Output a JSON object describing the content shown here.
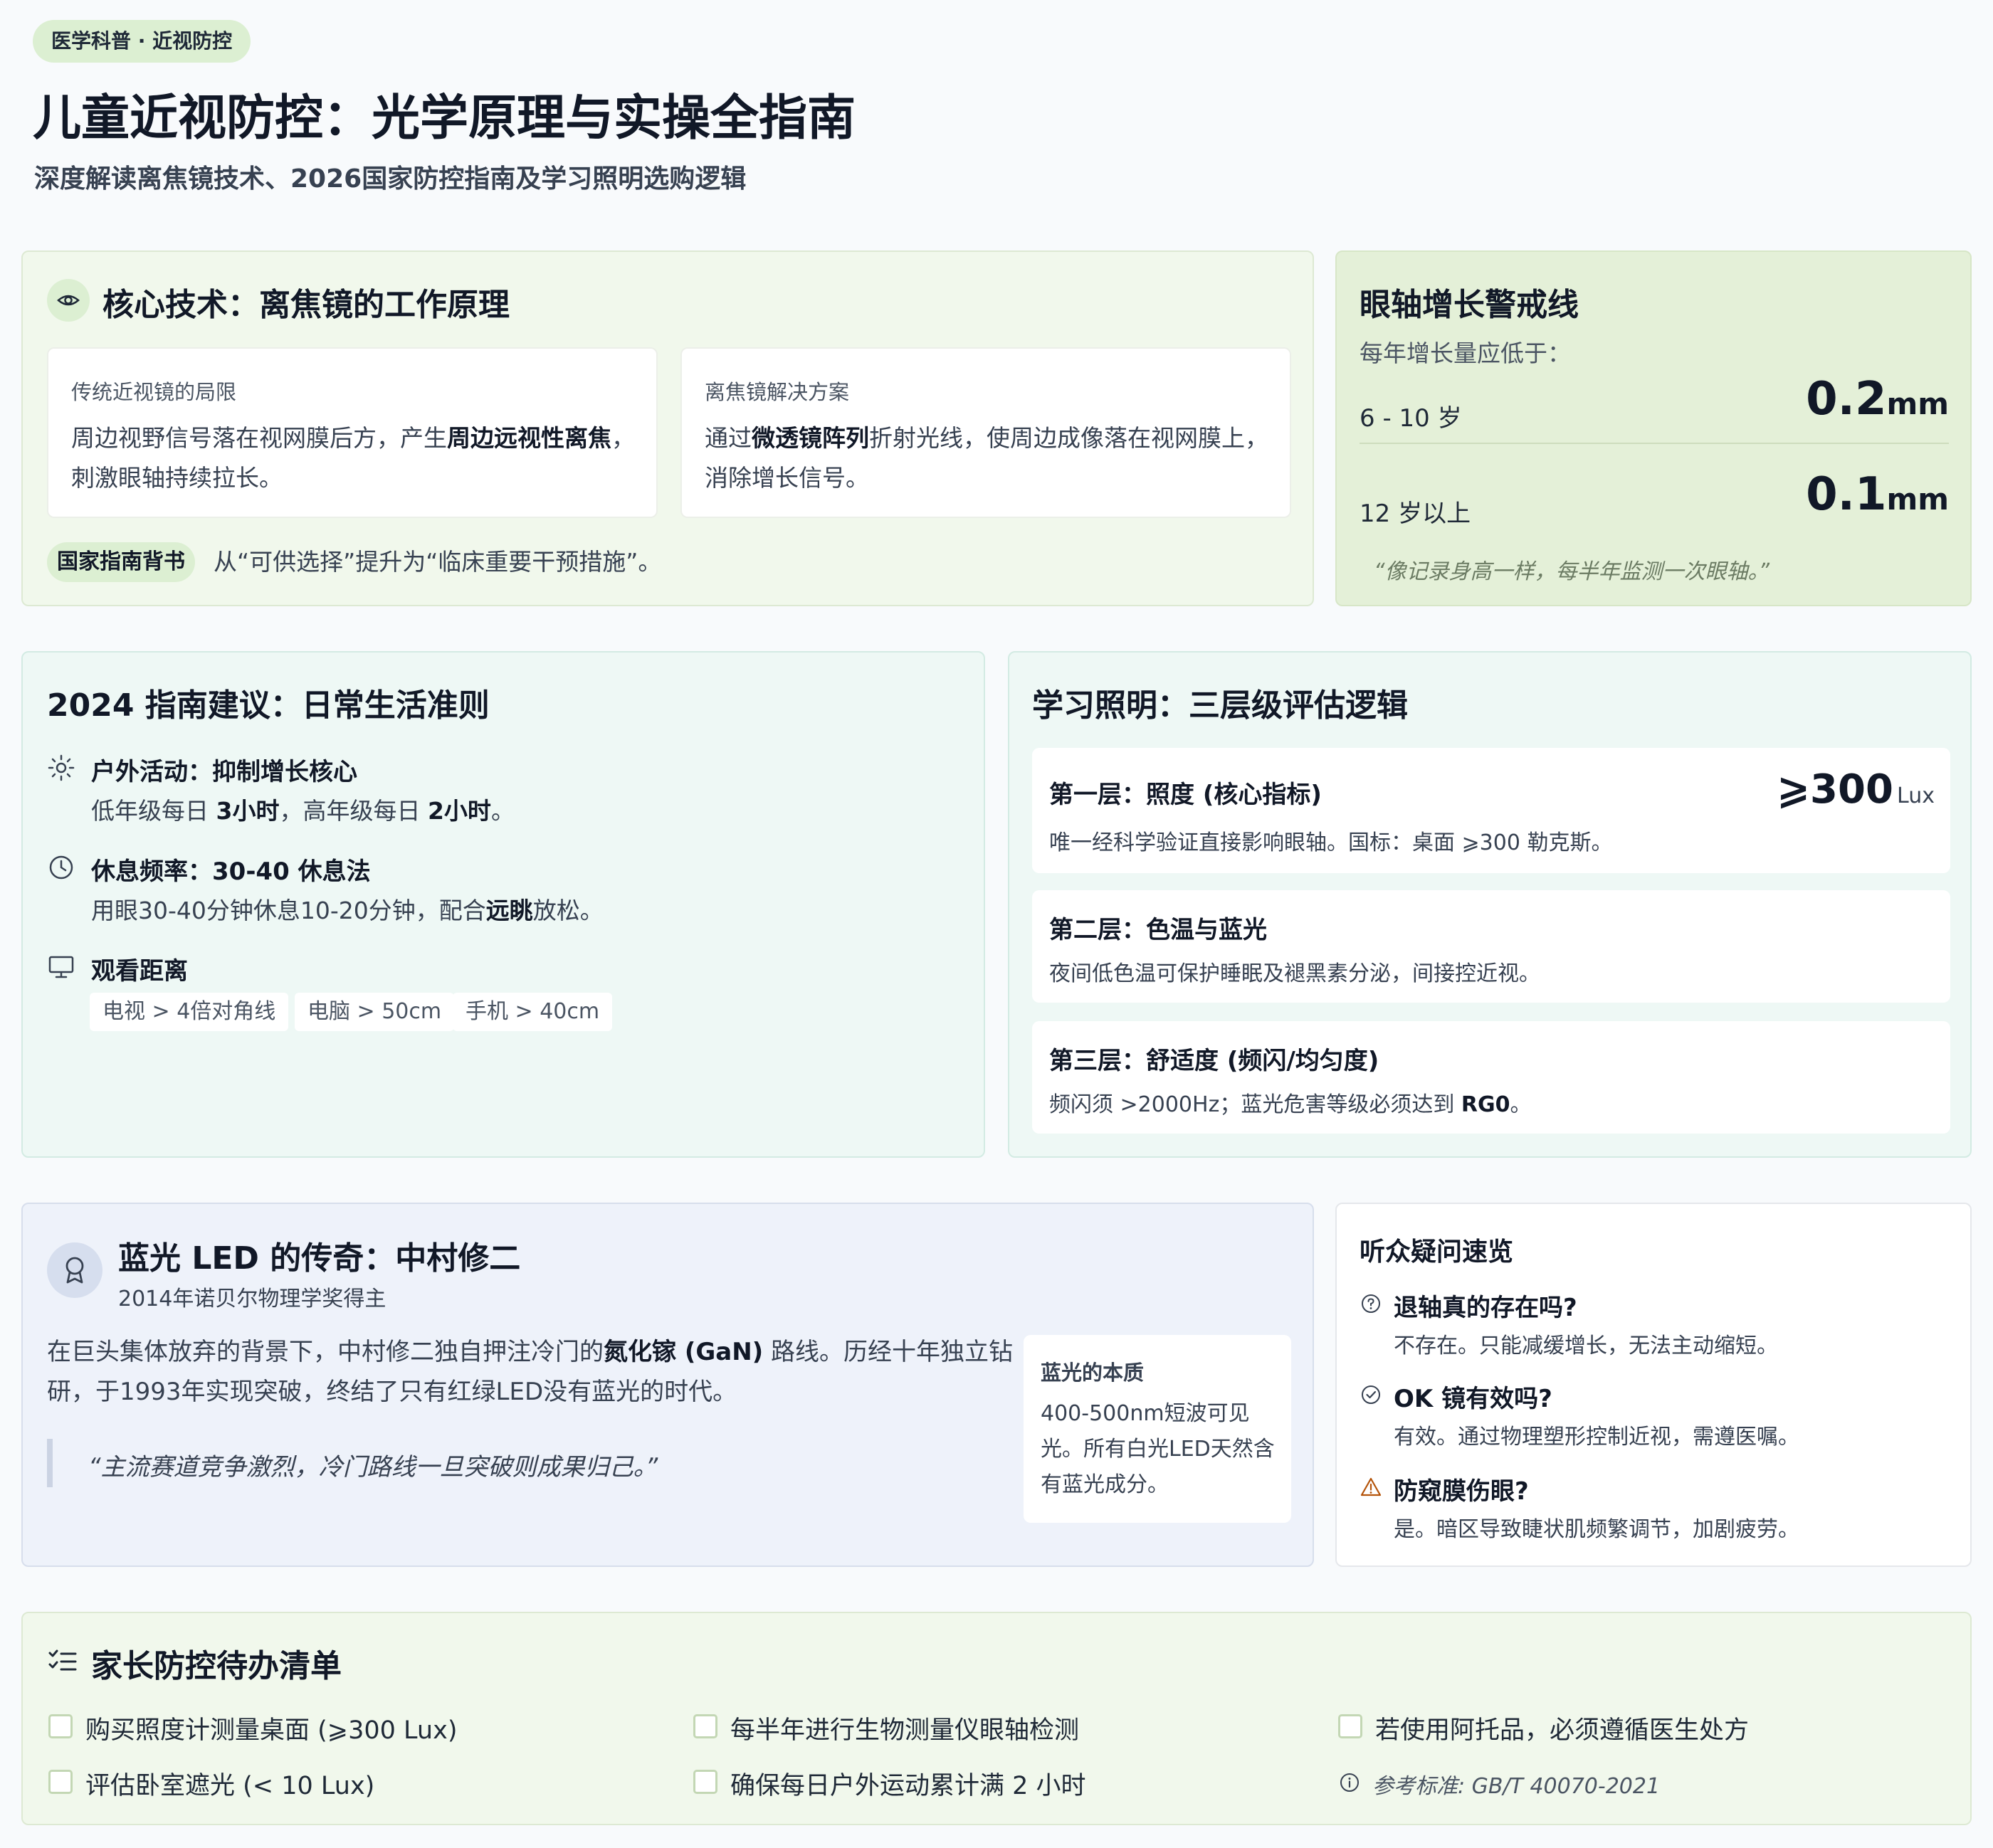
{
  "header": {
    "tag": "医学科普 · 近视防控",
    "title": "儿童近视防控：光学原理与实操全指南",
    "subtitle": "深度解读离焦镜技术、2026国家防控指南及学习照明选购逻辑"
  },
  "defocus": {
    "title": "核心技术：离焦镜的工作原理",
    "traditional": {
      "label": "传统近视镜的局限",
      "text_pre": "周边视野信号落在视网膜后方，产生",
      "text_bold": "周边远视性离焦",
      "text_post": "，刺激眼轴持续拉长。"
    },
    "solution": {
      "label": "离焦镜解决方案",
      "text_pre": "通过",
      "text_bold": "微透镜阵列",
      "text_post": "折射光线，使周边成像落在视网膜上，消除增长信号。"
    },
    "badge": "国家指南背书",
    "badge_text": "从“可供选择”提升为“临床重要干预措施”。"
  },
  "axial": {
    "title": "眼轴增长警戒线",
    "subtitle": "每年增长量应低于：",
    "rows": [
      {
        "age": "6 - 10 岁",
        "value": "0.2",
        "unit": "mm"
      },
      {
        "age": "12 岁以上",
        "value": "0.1",
        "unit": "mm"
      }
    ],
    "quote": "“像记录身高一样，每半年监测一次眼轴。”"
  },
  "guide": {
    "title": "2024 指南建议：日常生活准则",
    "outdoor": {
      "title": "户外活动：抑制增长核心",
      "t1": "低年级每日 ",
      "b1": "3小时",
      "t2": "，高年级每日 ",
      "b2": "2小时",
      "t3": "。"
    },
    "rest": {
      "title": "休息频率：30-40 休息法",
      "t1": "用眼30-40分钟休息10-20分钟，配合",
      "b1": "远眺",
      "t2": "放松。"
    },
    "distance": {
      "title": "观看距离",
      "chips": [
        "电视 > 4倍对角线",
        "电脑 > 50cm",
        "手机 > 40cm"
      ]
    }
  },
  "lighting": {
    "title": "学习照明：三层级评估逻辑",
    "layers": [
      {
        "title": "第一层：照度 (核心指标)",
        "desc": "唯一经科学验证直接影响眼轴。国标：桌面 ⩾300 勒克斯。",
        "value": "⩾300",
        "unit": "Lux"
      },
      {
        "title": "第二层：色温与蓝光",
        "desc": "夜间低色温可保护睡眠及褪黑素分泌，间接控近视。"
      },
      {
        "title": "第三层：舒适度 (频闪/均匀度)",
        "desc_pre": "频闪须 >2000Hz；蓝光危害等级必须达到 ",
        "desc_bold": "RG0",
        "desc_post": "。"
      }
    ]
  },
  "led": {
    "title": "蓝光 LED 的传奇：中村修二",
    "subtitle": "2014年诺贝尔物理学奖得主",
    "p_pre": "在巨头集体放弃的背景下，中村修二独自押注冷门的",
    "p_bold": "氮化镓 (GaN)",
    "p_post": " 路线。历经十年独立钻研，于1993年实现突破，终结了只有红绿LED没有蓝光的时代。",
    "quote": "“主流赛道竞争激烈，冷门路线一旦突破则成果归己。”",
    "box_title": "蓝光的本质",
    "box_text": "400-500nm短波可见光。所有白光LED天然含有蓝光成分。"
  },
  "faq": {
    "title": "听众疑问速览",
    "items": [
      {
        "q": "退轴真的存在吗?",
        "a": "不存在。只能减缓增长，无法主动缩短。",
        "icon": "question-icon"
      },
      {
        "q": "OK 镜有效吗?",
        "a": "有效。通过物理塑形控制近视，需遵医嘱。",
        "icon": "check-circle-icon"
      },
      {
        "q": "防窥膜伤眼?",
        "a": "是。暗区导致睫状肌频繁调节，加剧疲劳。",
        "icon": "warning-icon"
      }
    ]
  },
  "todo": {
    "title": "家长防控待办清单",
    "items": [
      "购买照度计测量桌面 (⩾300 Lux)",
      "每半年进行生物测量仪眼轴检测",
      "若使用阿托品，必须遵循医生处方",
      "评估卧室遮光 (< 10 Lux)",
      "确保每日户外运动累计满 2 小时"
    ],
    "reference": "参考标准: GB/T 40070-2021"
  }
}
